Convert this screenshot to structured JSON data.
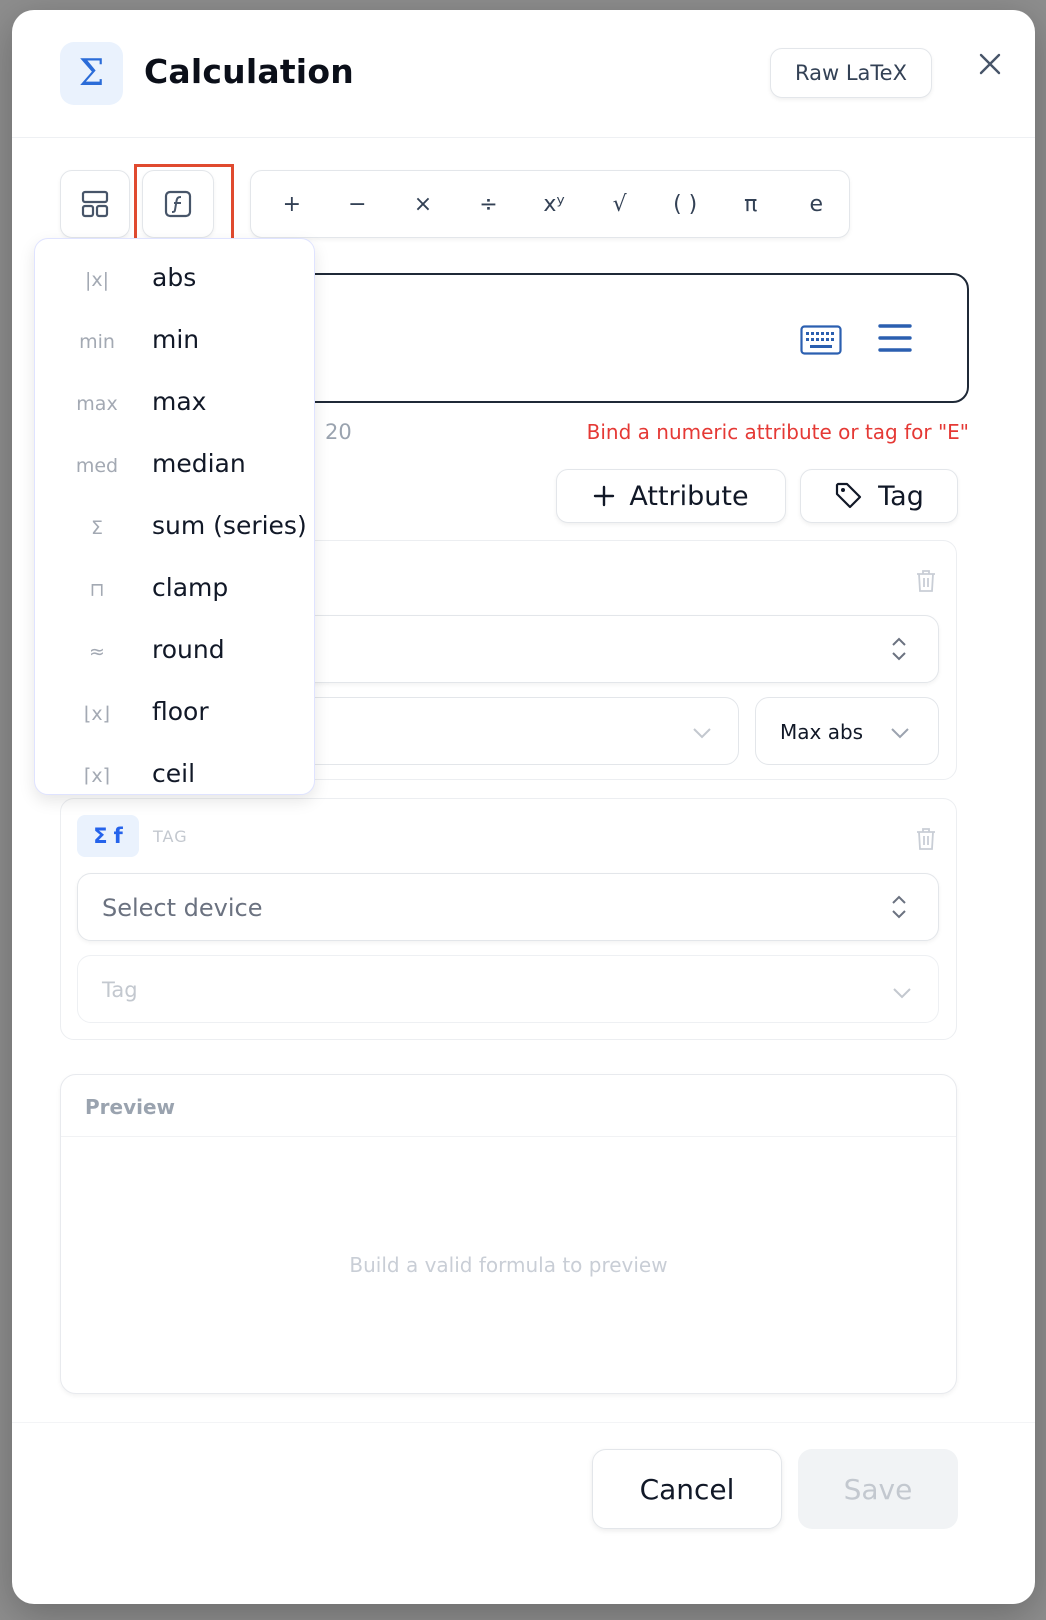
{
  "modal": {
    "title": "Calculation",
    "title_icon": "sigma-icon",
    "raw_latex_label": "Raw LaTeX",
    "close_label": "×"
  },
  "toolbar": {
    "layout_icon": "layout-icon",
    "function_icon": "function-icon",
    "operators": [
      "+",
      "−",
      "×",
      "÷",
      "xʸ",
      "√",
      "( )",
      "π",
      "e"
    ]
  },
  "formula": {
    "keyboard_icon": "keyboard-icon",
    "menu_icon": "hamburger-icon",
    "hint_suffix": "20",
    "error": "Bind a numeric attribute or tag for \"E\""
  },
  "buttons": {
    "attribute_label": "Attribute",
    "tag_label": "Tag"
  },
  "card1": {
    "aggregate_value": "Max abs"
  },
  "card2": {
    "badge_sigma": "Σ",
    "badge_f": "f",
    "type_label": "TAG",
    "device_placeholder": "Select device",
    "tag_placeholder": "Tag"
  },
  "preview": {
    "title": "Preview",
    "empty_text": "Build a valid formula to preview"
  },
  "footer": {
    "cancel_label": "Cancel",
    "save_label": "Save"
  },
  "function_menu": {
    "items": [
      {
        "symbol": "|x|",
        "label": "abs"
      },
      {
        "symbol": "min",
        "label": "min"
      },
      {
        "symbol": "max",
        "label": "max"
      },
      {
        "symbol": "med",
        "label": "median"
      },
      {
        "symbol": "Σ",
        "label": "sum (series)"
      },
      {
        "symbol": "⊓",
        "label": "clamp"
      },
      {
        "symbol": "≈",
        "label": "round"
      },
      {
        "symbol": "⌊x⌋",
        "label": "floor"
      },
      {
        "symbol": "⌈x⌉",
        "label": "ceil"
      }
    ]
  },
  "colors": {
    "accent": "#2563eb",
    "error": "#e53935",
    "highlight_outline": "#e04a2f"
  }
}
